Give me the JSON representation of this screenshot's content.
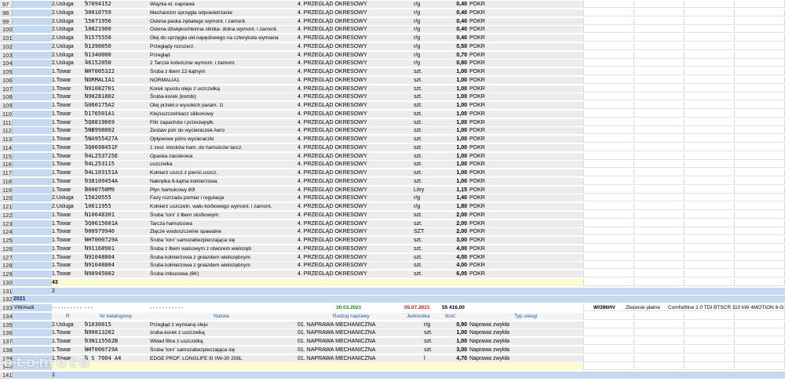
{
  "rows_a": [
    {
      "n": "97",
      "type": "2.Usluga",
      "code": "97094152",
      "desc": "Wiązka el. naprawa",
      "cat": "4. PRZEGLĄD OKRESOWY",
      "unit": "r/g",
      "qty": "0,40",
      "stat": "POKR"
    },
    {
      "n": "98",
      "type": "2.Usluga",
      "code": "30010759",
      "desc": "Mechanizm sprzęgła odpowietrzanie",
      "cat": "4. PRZEGLĄD OKRESOWY",
      "unit": "r/g",
      "qty": "0,40",
      "stat": "POKR"
    },
    {
      "n": "99",
      "type": "2.Usluga",
      "code": "15871956",
      "desc": "Osłona paska zębatego wymont. i zamont.",
      "cat": "4. PRZEGLĄD OKRESOWY",
      "unit": "r/g",
      "qty": "0,40",
      "stat": "POKR"
    },
    {
      "n": "100",
      "type": "2.Usluga",
      "code": "10821900",
      "desc": "Osłona dźwiękochłonna silnika- dolna wymont. i zamont.",
      "cat": "4. PRZEGLĄD OKRESOWY",
      "unit": "r/g",
      "qty": "0,40",
      "stat": "POKR"
    },
    {
      "n": "101",
      "type": "2.Usluga",
      "code": "01575550",
      "desc": "Olej do sprzęgła ukł.napędowego na czterykoła wymiana",
      "cat": "4. PRZEGLĄD OKRESOWY",
      "unit": "r/g",
      "qty": "0,40",
      "stat": "POKR"
    },
    {
      "n": "102",
      "type": "2.Usluga",
      "code": "01390050",
      "desc": "Przeglądy rozszerz.",
      "cat": "4. PRZEGLĄD OKRESOWY",
      "unit": "r/g",
      "qty": "0,50",
      "stat": "POKR"
    },
    {
      "n": "103",
      "type": "2.Usluga",
      "code": "01340000",
      "desc": "Przegląd",
      "cat": "4. PRZEGLĄD OKRESOWY",
      "unit": "r/g",
      "qty": "0,70",
      "stat": "POKR"
    },
    {
      "n": "104",
      "type": "2.Usluga",
      "code": "46152050",
      "desc": "2 Tarcze kotwiczne wymont. i zamont.",
      "cat": "4. PRZEGLĄD OKRESOWY",
      "unit": "r/g",
      "qty": "0,80",
      "stat": "POKR"
    },
    {
      "n": "105",
      "type": "1.Towar",
      "code": "WHT005322",
      "desc": "Śruba z łbem 12-kątnym",
      "cat": "4. PRZEGLĄD OKRESOWY",
      "unit": "szt.",
      "qty": "1,00",
      "stat": "POKR"
    },
    {
      "n": "106",
      "type": "1.Towar",
      "code": "NORMALIA1",
      "desc": "NORMALIA1",
      "cat": "4. PRZEGLĄD OKRESOWY",
      "unit": "szt.",
      "qty": "1,00",
      "stat": "POKR"
    },
    {
      "n": "107",
      "type": "1.Towar",
      "code": "N91082701",
      "desc": "Korek spustu oleju z uszczelką",
      "cat": "4. PRZEGLĄD OKRESOWY",
      "unit": "szt.",
      "qty": "1,00",
      "stat": "POKR"
    },
    {
      "n": "108",
      "type": "1.Towar",
      "code": "N90281802",
      "desc": "Śruba-korek (kombi)",
      "cat": "4. PRZEGLĄD OKRESOWY",
      "unit": "szt.",
      "qty": "1,00",
      "stat": "POKR"
    },
    {
      "n": "109",
      "type": "1.Towar",
      "code": "G060175A2",
      "desc": "Olej przekł.o wysokich param. 1l",
      "cat": "4. PRZEGLĄD OKRESOWY",
      "unit": "szt.",
      "qty": "1,00",
      "stat": "POKR"
    },
    {
      "n": "110",
      "type": "1.Towar",
      "code": "D176501A1",
      "desc": "Klej/uszczelniacz silikonowy",
      "cat": "4. PRZEGLĄD OKRESOWY",
      "unit": "szt.",
      "qty": "1,00",
      "stat": "POKR"
    },
    {
      "n": "111",
      "type": "1.Towar",
      "code": "5Q0819669",
      "desc": "Filtr zapachów i przeciwpyłk.",
      "cat": "4. PRZEGLĄD OKRESOWY",
      "unit": "szt.",
      "qty": "1,00",
      "stat": "POKR"
    },
    {
      "n": "112",
      "type": "1.Towar",
      "code": "5NB998002",
      "desc": "Zestaw piór do wycieraczek Aero",
      "cat": "4. PRZEGLĄD OKRESOWY",
      "unit": "szt.",
      "qty": "1,00",
      "stat": "POKR"
    },
    {
      "n": "113",
      "type": "1.Towar",
      "code": "5NA955427A",
      "desc": "Opływowe pióro wycieraczki",
      "cat": "4. PRZEGLĄD OKRESOWY",
      "unit": "szt.",
      "qty": "1,00",
      "stat": "POKR"
    },
    {
      "n": "114",
      "type": "1.Towar",
      "code": "3Q0698451F",
      "desc": "1 zest. klocków ham. do hamulców tarcz.",
      "cat": "4. PRZEGLĄD OKRESOWY",
      "unit": "szt.",
      "qty": "1,00",
      "stat": "POKR"
    },
    {
      "n": "115",
      "type": "1.Towar",
      "code": "04L253725E",
      "desc": "Opaska zaciskowa",
      "cat": "4. PRZEGLĄD OKRESOWY",
      "unit": "szt.",
      "qty": "1,00",
      "stat": "POKR"
    },
    {
      "n": "116",
      "type": "1.Towar",
      "code": "04L253115",
      "desc": "uszczelka",
      "cat": "4. PRZEGLĄD OKRESOWY",
      "unit": "szt.",
      "qty": "1,00",
      "stat": "POKR"
    },
    {
      "n": "117",
      "type": "1.Towar",
      "code": "04L103151A",
      "desc": "Kołnierz uszcz.z pierśc.uszcz.",
      "cat": "4. PRZEGLĄD OKRESOWY",
      "unit": "szt.",
      "qty": "1,00",
      "stat": "POKR"
    },
    {
      "n": "118",
      "type": "1.Towar",
      "code": "038109454A",
      "desc": "Nakrętka 6-kątna kołnierzowa",
      "cat": "4. PRZEGLĄD OKRESOWY",
      "unit": "szt.",
      "qty": "1,00",
      "stat": "POKR"
    },
    {
      "n": "119",
      "type": "1.Towar",
      "code": "B000750M9",
      "desc": "Płyn hamulcowy 80l",
      "cat": "4. PRZEGLĄD OKRESOWY",
      "unit": "Litry",
      "qty": "1,15",
      "stat": "POKR"
    },
    {
      "n": "120",
      "type": "2.Usluga",
      "code": "15020555",
      "desc": "Fazy rozrzadu pomiar i regulacja",
      "cat": "4. PRZEGLĄD OKRESOWY",
      "unit": "r/g",
      "qty": "1,40",
      "stat": "POKR"
    },
    {
      "n": "121",
      "type": "2.Usluga",
      "code": "10611955",
      "desc": "Kołnierz uszczeln. wału korbowego wymont. i zamont.",
      "cat": "4. PRZEGLĄD OKRESOWY",
      "unit": "r/g",
      "qty": "1,80",
      "stat": "POKR"
    },
    {
      "n": "122",
      "type": "1.Towar",
      "code": "N10648301",
      "desc": "Śruba 'torx' z łbem stożkowym",
      "cat": "4. PRZEGLĄD OKRESOWY",
      "unit": "szt.",
      "qty": "2,00",
      "stat": "POKR"
    },
    {
      "n": "123",
      "type": "1.Towar",
      "code": "3Q0615601A",
      "desc": "Tarcza hamulcowa",
      "cat": "4. PRZEGLĄD OKRESOWY",
      "unit": "szt.",
      "qty": "2,00",
      "stat": "POKR"
    },
    {
      "n": "124",
      "type": "1.Towar",
      "code": "000979940",
      "desc": "Złącze wodoszczelne spawalne",
      "cat": "4. PRZEGLĄD OKRESOWY",
      "unit": "SZT",
      "qty": "2,00",
      "stat": "POKR"
    },
    {
      "n": "125",
      "type": "1.Towar",
      "code": "WHT000729A",
      "desc": "Śruba 'torx' samozabezpieczająca się",
      "cat": "4. PRZEGLĄD OKRESOWY",
      "unit": "szt.",
      "qty": "3,00",
      "stat": "POKR"
    },
    {
      "n": "126",
      "type": "1.Towar",
      "code": "N91168901",
      "desc": "Śruba z łbem walcowym z otworem wielozęb",
      "cat": "4. PRZEGLĄD OKRESOWY",
      "unit": "szt.",
      "qty": "4,00",
      "stat": "POKR"
    },
    {
      "n": "127",
      "type": "1.Towar",
      "code": "N91048804",
      "desc": "Śruba kołnierzowa z gniazdem wielozębnym",
      "cat": "4. PRZEGLĄD OKRESOWY",
      "unit": "szt.",
      "qty": "4,00",
      "stat": "POKR"
    },
    {
      "n": "128",
      "type": "1.Towar",
      "code": "N91048804",
      "desc": "Śruba kołnierzowa z gniazdem wielozębnym",
      "cat": "4. PRZEGLĄD OKRESOWY",
      "unit": "szt.",
      "qty": "4,00",
      "stat": "POKR"
    },
    {
      "n": "129",
      "type": "1.Towar",
      "code": "N90945002",
      "desc": "Śruba imbusowa (6K)",
      "cat": "4. PRZEGLĄD OKRESOWY",
      "unit": "szt.",
      "qty": "6,00",
      "stat": "POKR"
    }
  ],
  "row130": {
    "n": "130",
    "value": "43"
  },
  "row131": {
    "n": "131",
    "value": "2"
  },
  "row132": {
    "n": "132",
    "value": "2021"
  },
  "row133": {
    "n": "133",
    "make": "VW/Audi",
    "dashes1": "- - - - - - - - - -",
    "dashes2": "- - -",
    "dashes3": "- - - - - - - - - - -",
    "date1": "30.03.2021",
    "date2": "05.07.2021",
    "amount": "55 416,00",
    "plate": "WI396HV",
    "order": "Zlecenie płatne",
    "model": "Comfortline 2.0 TDI BTSCR 110 kW 4MOTION 6-G"
  },
  "row134": {
    "n": "134",
    "h_r": "R",
    "h_catalog": "Nr katalogowy",
    "h_name": "Nazwa",
    "h_type": "Rodzaj naprawy",
    "h_unit": "Jednostka",
    "h_qty": "Ilość",
    "h_service": "Typ usługi"
  },
  "rows_b": [
    {
      "n": "135",
      "type": "2.Usluga",
      "code": "01030015",
      "desc": "Przegląd z wymianą oleju",
      "cat": "01. NAPRAWA MECHANICZNA",
      "unit": "r/g",
      "qty": "0,90",
      "stat": "Naprawa zwykła"
    },
    {
      "n": "136",
      "type": "1.Towar",
      "code": "N90813202",
      "desc": "śruba-korek z uszczelką",
      "cat": "01. NAPRAWA MECHANICZNA",
      "unit": "szt.",
      "qty": "1,00",
      "stat": "Naprawa zwykła"
    },
    {
      "n": "137",
      "type": "1.Towar",
      "code": "03N115562B",
      "desc": "Wkład filtra z uszczelką",
      "cat": "01. NAPRAWA MECHANICZNA",
      "unit": "szt.",
      "qty": "1,00",
      "stat": "Naprawa zwykła"
    },
    {
      "n": "138",
      "type": "1.Towar",
      "code": "WHT000729A",
      "desc": "Śruba 'torx' samozabezpieczająca się",
      "cat": "01. NAPRAWA MECHANICZNA",
      "unit": "szt.",
      "qty": "3,00",
      "stat": "Naprawa zwykła"
    },
    {
      "n": "139",
      "type": "1.Towar",
      "code": "G S 7004 A4",
      "desc": "EDGE PROF. LONGLIFE III 0W-30 208L",
      "cat": "01. NAPRAWA MECHANICZNA",
      "unit": "l",
      "qty": "4,70",
      "stat": "Naprawa zwykła"
    }
  ],
  "row140": {
    "n": "140",
    "value": ""
  },
  "row141": {
    "n": "141",
    "value": "1"
  },
  "watermark": "otomoto"
}
